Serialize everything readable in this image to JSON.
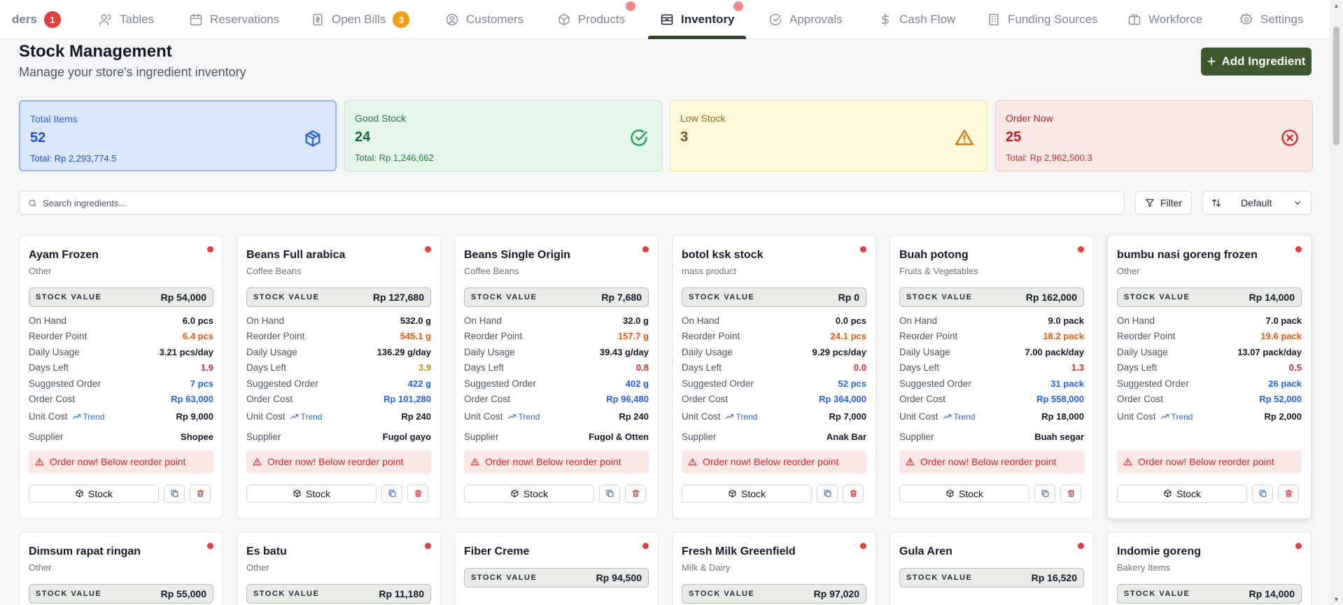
{
  "nav": {
    "items": [
      {
        "label": "ders",
        "badge": "1",
        "badge_color": "#e53e3e",
        "icon": "none"
      },
      {
        "label": "Tables",
        "icon": "users-icon"
      },
      {
        "label": "Reservations",
        "icon": "calendar-icon"
      },
      {
        "label": "Open Bills",
        "badge": "3",
        "badge_color": "#f59e0b",
        "icon": "receipt-icon"
      },
      {
        "label": "Customers",
        "icon": "user-circle-icon"
      },
      {
        "label": "Products",
        "icon": "box-icon"
      },
      {
        "label": "Inventory",
        "icon": "archive-icon",
        "active": true
      },
      {
        "label": "Approvals",
        "icon": "check-circle-icon"
      },
      {
        "label": "Cash Flow",
        "icon": "dollar-icon"
      },
      {
        "label": "Funding Sources",
        "icon": "building-icon"
      },
      {
        "label": "Workforce",
        "icon": "briefcase-icon"
      },
      {
        "label": "Settings",
        "icon": "gear-icon"
      }
    ]
  },
  "header": {
    "title": "Stock Management",
    "subtitle": "Manage your store's ingredient inventory",
    "add_button": "Add Ingredient"
  },
  "summary": [
    {
      "label": "Total Items",
      "value": "52",
      "total": "Total: Rp 2,293,774.5",
      "icon": "cube-icon",
      "color": "#2563eb"
    },
    {
      "label": "Good Stock",
      "value": "24",
      "total": "Total: Rp 1,246,662",
      "icon": "check-circle-icon",
      "color": "#15803d"
    },
    {
      "label": "Low Stock",
      "value": "3",
      "total": "",
      "icon": "warning-icon",
      "color": "#a16207"
    },
    {
      "label": "Order Now",
      "value": "25",
      "total": "Total: Rp 2,962,500.3",
      "icon": "x-circle-icon",
      "color": "#dc2626"
    }
  ],
  "search": {
    "placeholder": "Search ingredients..."
  },
  "filter_label": "Filter",
  "sort_value": "Default",
  "labels": {
    "stock_value": "STOCK VALUE",
    "on_hand": "On Hand",
    "reorder_point": "Reorder Point",
    "daily_usage": "Daily Usage",
    "days_left": "Days Left",
    "suggested_order": "Suggested Order",
    "order_cost": "Order Cost",
    "unit_cost": "Unit Cost",
    "trend": "Trend",
    "supplier": "Supplier",
    "alert": "Order now! Below reorder point",
    "stock_button": "Stock"
  },
  "colors": {
    "reorder": "#ea580c",
    "days_red": "#dc2626",
    "days_amber": "#ca8a04",
    "blue": "#2563eb"
  },
  "ingredients": [
    {
      "name": "Ayam Frozen",
      "category": "Other",
      "stock_value": "Rp 54,000",
      "on_hand": "6.0 pcs",
      "reorder_point": "6.4 pcs",
      "daily_usage": "3.21 pcs/day",
      "days_left": "1.9",
      "days_color": "red",
      "suggested_order": "7 pcs",
      "order_cost": "Rp 63,000",
      "unit_cost": "Rp 9,000",
      "supplier": "Shopee"
    },
    {
      "name": "Beans Full arabica",
      "category": "Coffee Beans",
      "stock_value": "Rp 127,680",
      "on_hand": "532.0 g",
      "reorder_point": "545.1 g",
      "daily_usage": "136.29 g/day",
      "days_left": "3.9",
      "days_color": "amber",
      "suggested_order": "422 g",
      "order_cost": "Rp 101,280",
      "unit_cost": "Rp 240",
      "supplier": "Fugol gayo"
    },
    {
      "name": "Beans Single Origin",
      "category": "Coffee Beans",
      "stock_value": "Rp 7,680",
      "on_hand": "32.0 g",
      "reorder_point": "157.7 g",
      "daily_usage": "39.43 g/day",
      "days_left": "0.8",
      "days_color": "red",
      "suggested_order": "402 g",
      "order_cost": "Rp 96,480",
      "unit_cost": "Rp 240",
      "supplier": "Fugol & Otten"
    },
    {
      "name": "botol ksk stock",
      "category": "mass product",
      "stock_value": "Rp 0",
      "on_hand": "0.0 pcs",
      "reorder_point": "24.1 pcs",
      "daily_usage": "9.29 pcs/day",
      "days_left": "0.0",
      "days_color": "red",
      "suggested_order": "52 pcs",
      "order_cost": "Rp 364,000",
      "unit_cost": "Rp 7,000",
      "supplier": "Anak Bar"
    },
    {
      "name": "Buah potong",
      "category": "Fruits & Vegetables",
      "stock_value": "Rp 162,000",
      "on_hand": "9.0 pack",
      "reorder_point": "18.2 pack",
      "daily_usage": "7.00 pack/day",
      "days_left": "1.3",
      "days_color": "red",
      "suggested_order": "31 pack",
      "order_cost": "Rp 558,000",
      "unit_cost": "Rp 18,000",
      "supplier": "Buah segar"
    },
    {
      "name": "bumbu nasi goreng frozen",
      "category": "Other",
      "stock_value": "Rp 14,000",
      "on_hand": "7.0 pack",
      "reorder_point": "19.6 pack",
      "daily_usage": "13.07 pack/day",
      "days_left": "0.5",
      "days_color": "red",
      "suggested_order": "26 pack",
      "order_cost": "Rp 52,000",
      "unit_cost": "Rp 2,000",
      "supplier": ""
    }
  ],
  "ingredients_row2": [
    {
      "name": "Dimsum rapat ringan",
      "category": "Other",
      "stock_value": "Rp 55,000"
    },
    {
      "name": "Es batu",
      "category": "Other",
      "stock_value": "Rp 11,180"
    },
    {
      "name": "Fiber Creme",
      "category": "",
      "stock_value": "Rp 94,500"
    },
    {
      "name": "Fresh Milk Greenfield",
      "category": "Milk & Dairy",
      "stock_value": "Rp 97,020"
    },
    {
      "name": "Gula Aren",
      "category": "",
      "stock_value": "Rp 16,520"
    },
    {
      "name": "Indomie goreng",
      "category": "Bakery Items",
      "stock_value": "Rp 14,000"
    }
  ]
}
